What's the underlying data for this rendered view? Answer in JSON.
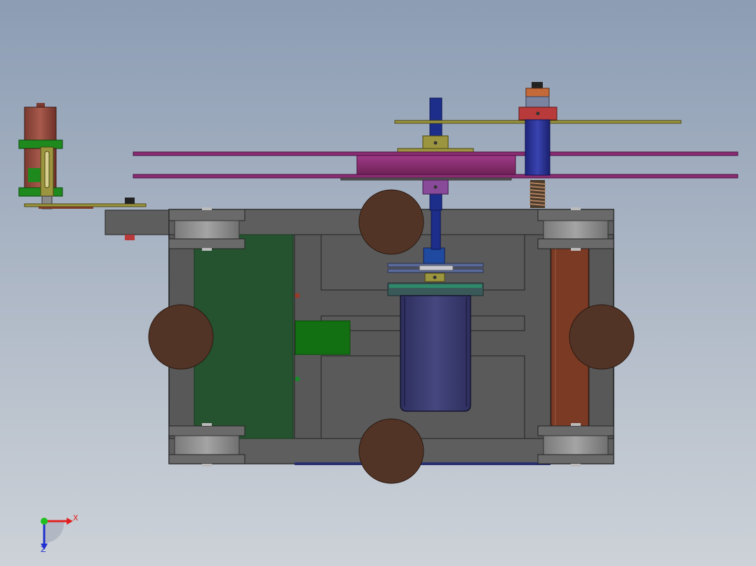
{
  "view": {
    "background_top": "#8c9db4",
    "background_bottom": "#cdd2d8"
  },
  "model": {
    "frame_color": "#595959",
    "wheel_color": "#523426",
    "left_board_color": "#25522f",
    "right_board_color": "#7a3a24",
    "motor_color": "#393a6c",
    "disc_color": "#8a2c72",
    "pulley_color": "#7c2a62",
    "shaft_blue_color": "#1c2d8a",
    "plate_gold_color": "#9c9540"
  },
  "triad": {
    "x_label": "X",
    "z_label": "Z",
    "x_color": "#e02020",
    "y_color": "#20c020",
    "z_color": "#2030d0",
    "icon": "coordinate-triad-icon"
  }
}
